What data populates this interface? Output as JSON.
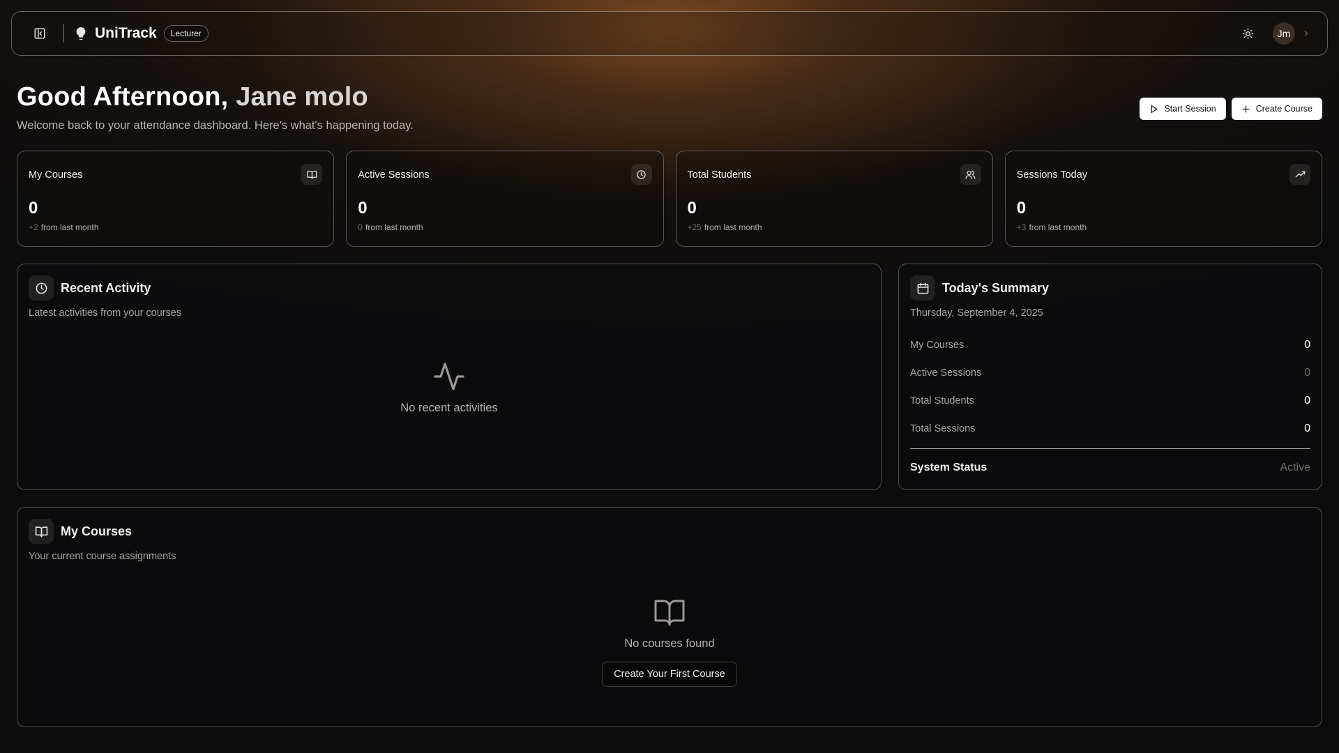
{
  "header": {
    "brand": "UniTrack",
    "role_badge": "Lecturer",
    "avatar_initials": "Jm"
  },
  "greeting": {
    "salutation": "Good Afternoon,",
    "name": "Jane molo",
    "subtitle": "Welcome back to your attendance dashboard. Here's what's happening today."
  },
  "actions": {
    "start_session": "Start Session",
    "create_course": "Create Course"
  },
  "stats": [
    {
      "title": "My Courses",
      "value": "0",
      "delta": "+2",
      "sub": "from last month",
      "icon": "book-icon"
    },
    {
      "title": "Active Sessions",
      "value": "0",
      "delta": "0",
      "sub": "from last month",
      "icon": "clock-icon"
    },
    {
      "title": "Total Students",
      "value": "0",
      "delta": "+25",
      "sub": "from last month",
      "icon": "users-icon"
    },
    {
      "title": "Sessions Today",
      "value": "0",
      "delta": "+3",
      "sub": "from last month",
      "icon": "trending-up-icon"
    }
  ],
  "recent_activity": {
    "title": "Recent Activity",
    "subtitle": "Latest activities from your courses",
    "empty": "No recent activities"
  },
  "summary": {
    "title": "Today's Summary",
    "date": "Thursday, September 4, 2025",
    "rows": [
      {
        "label": "My Courses",
        "value": "0"
      },
      {
        "label": "Active Sessions",
        "value": "0"
      },
      {
        "label": "Total Students",
        "value": "0"
      },
      {
        "label": "Total Sessions",
        "value": "0"
      }
    ],
    "status_label": "System Status",
    "status_value": "Active"
  },
  "my_courses": {
    "title": "My Courses",
    "subtitle": "Your current course assignments",
    "empty": "No courses found",
    "cta": "Create Your First Course"
  }
}
